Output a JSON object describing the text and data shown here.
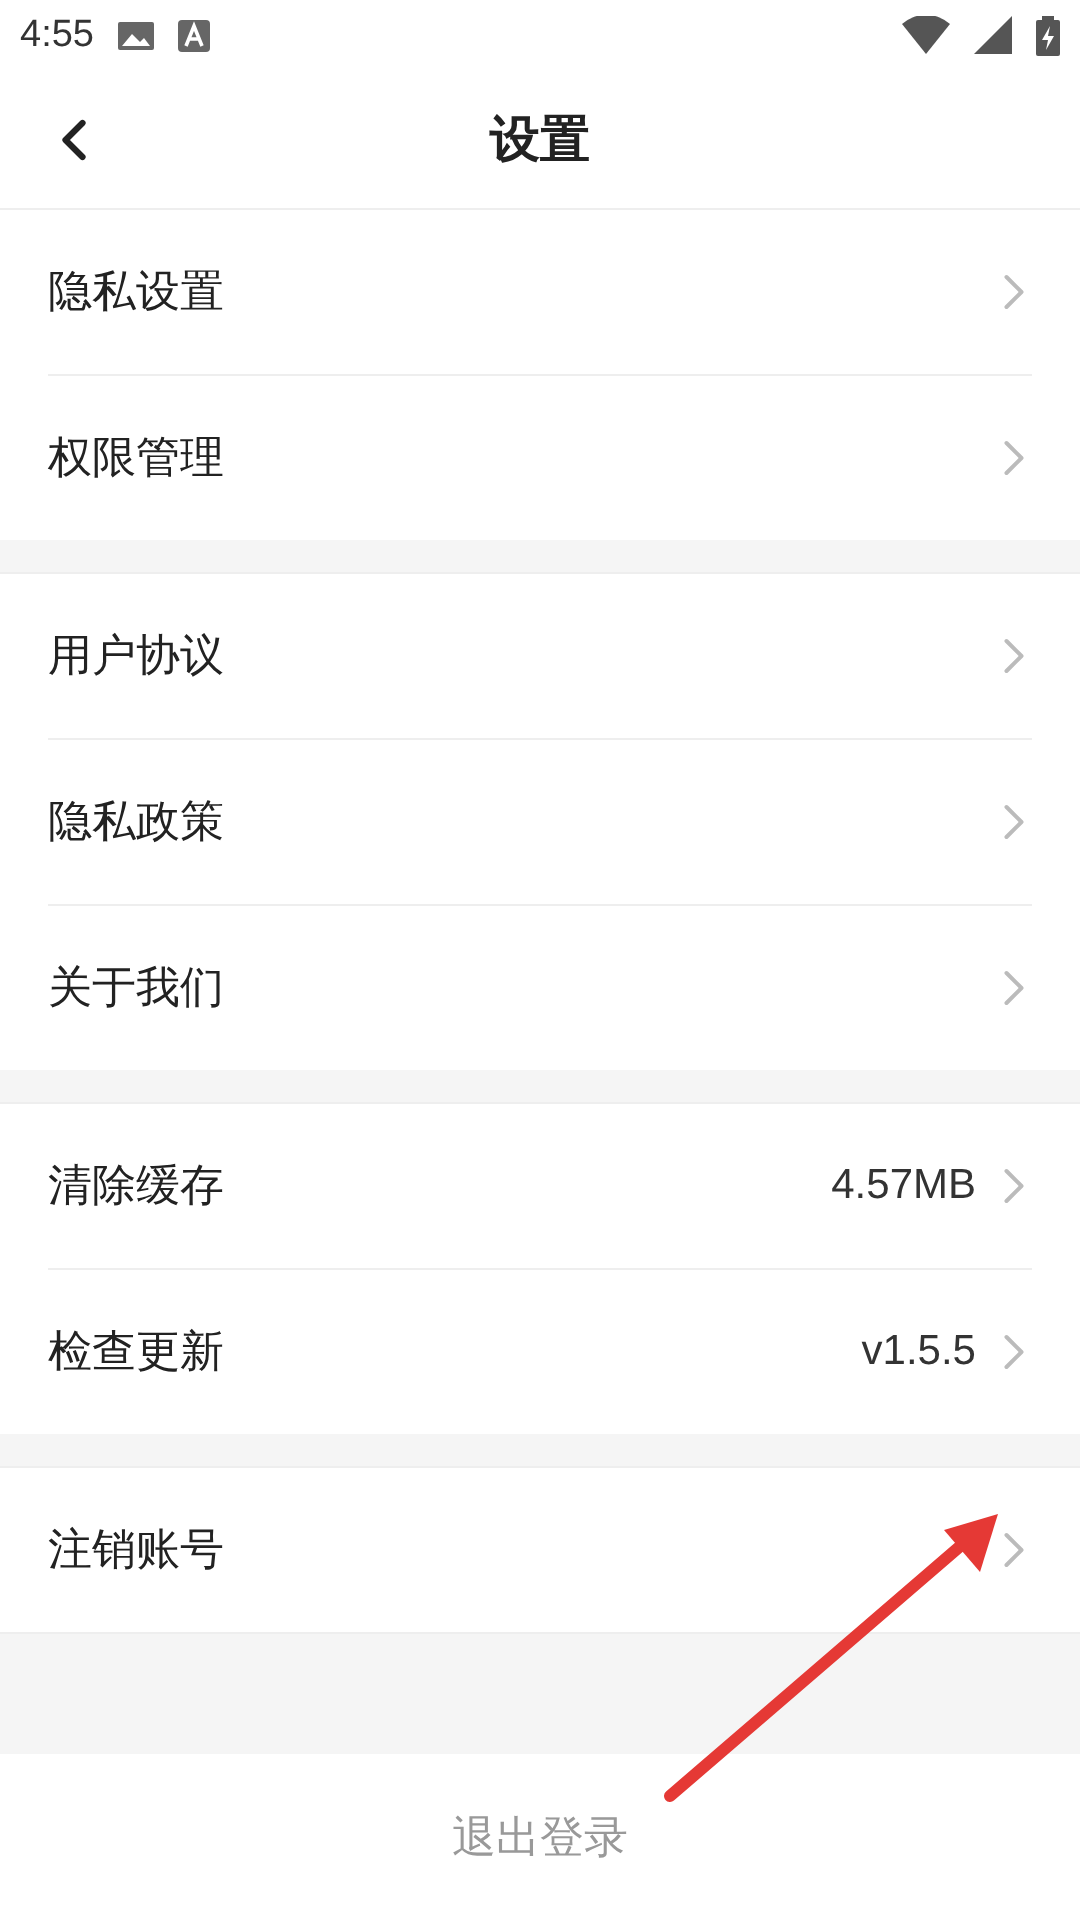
{
  "status_bar": {
    "time": "4:55"
  },
  "header": {
    "title": "设置"
  },
  "groups": [
    {
      "items": [
        {
          "label": "隐私设置"
        },
        {
          "label": "权限管理"
        }
      ]
    },
    {
      "items": [
        {
          "label": "用户协议"
        },
        {
          "label": "隐私政策"
        },
        {
          "label": "关于我们"
        }
      ]
    },
    {
      "items": [
        {
          "label": "清除缓存",
          "value": "4.57MB"
        },
        {
          "label": "检查更新",
          "value": "v1.5.5"
        }
      ]
    },
    {
      "items": [
        {
          "label": "注销账号"
        }
      ]
    }
  ],
  "logout": {
    "label": "退出登录"
  },
  "annotations": [
    {
      "kind": "arrow"
    }
  ]
}
